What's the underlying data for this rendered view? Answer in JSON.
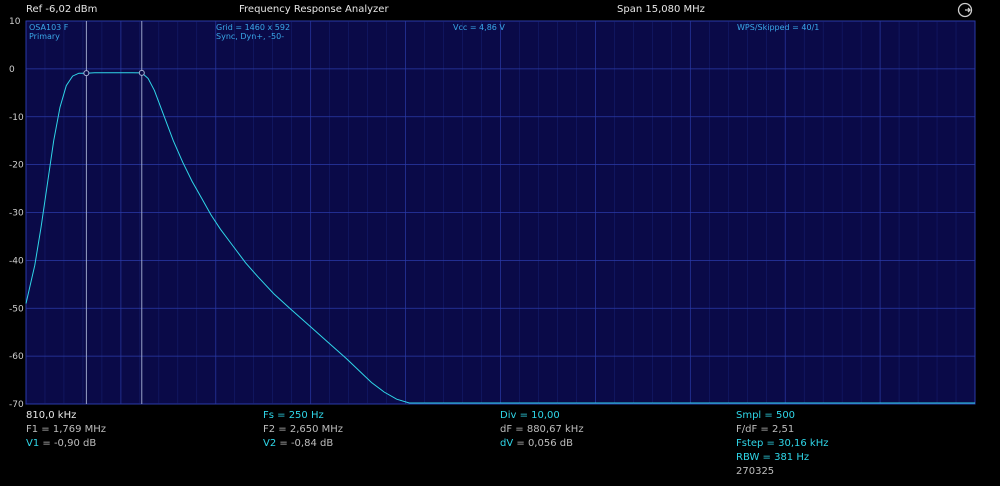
{
  "header": {
    "ref": "Ref  -6,02 dBm",
    "title": "Frequency Response Analyzer",
    "span": "Span 15,080 MHz"
  },
  "overlay": {
    "device": "OSA103 F",
    "mode": "Primary",
    "grid": "Grid = 1460 x 592",
    "sync": "Sync,  Dyn+,  -50-",
    "vcc": "Vcc = 4,86 V",
    "wps": "WPS/Skipped  = 40/1"
  },
  "footer": {
    "col1": {
      "start": "810,0 kHz",
      "f1": "F1 = 1,769 MHz",
      "v1_label": "V1",
      "v1_value": " = -0,90 dB"
    },
    "col2": {
      "fs": "Fs = 250 Hz",
      "f2": "F2 = 2,650 MHz",
      "v2_label": "V2",
      "v2_value": " = -0,84 dB"
    },
    "col3": {
      "div": "Div = 10,00",
      "df": "dF = 880,67 kHz",
      "dv_label": "dV",
      "dv_value": " = 0,056 dB"
    },
    "col4": {
      "smpl": "Smpl = 500",
      "fdf": "F/dF = 2,51",
      "fstep": "Fstep = 30,16 kHz",
      "rbw": "RBW = 381 Hz",
      "date": "270325"
    }
  },
  "colors": {
    "background": "#0a0a48",
    "grid": "#2a3aa8",
    "trace": "#2fd6e8",
    "marker": "#a9b3d6"
  },
  "icons": {
    "settings": "settings-icon"
  },
  "chart_data": {
    "type": "line",
    "xlabel": "",
    "ylabel": "",
    "x_unit": "MHz",
    "xlim": [
      0.81,
      15.89
    ],
    "ylim": [
      -70,
      10
    ],
    "yticks": [
      "10",
      "0",
      "-10",
      "-20",
      "-30",
      "-40",
      "-50",
      "-60",
      "-70"
    ],
    "grid": true,
    "markers": [
      {
        "label": "F1",
        "x": 1.769,
        "y": -0.9
      },
      {
        "label": "F2",
        "x": 2.65,
        "y": -0.84
      }
    ],
    "series": [
      {
        "x": [
          0.81,
          0.95,
          1.05,
          1.15,
          1.25,
          1.35,
          1.45,
          1.55,
          1.65,
          1.77,
          1.9,
          2.1,
          2.3,
          2.5,
          2.65,
          2.75,
          2.85,
          2.95,
          3.05,
          3.15,
          3.3,
          3.45,
          3.6,
          3.75,
          3.9,
          4.1,
          4.3,
          4.5,
          4.75,
          5.0,
          5.3,
          5.6,
          5.9,
          6.1,
          6.3,
          6.5,
          6.7,
          6.9,
          15.89
        ],
        "y": [
          -49,
          -41,
          -33,
          -24,
          -15,
          -8,
          -3.5,
          -1.5,
          -0.9,
          -0.9,
          -0.8,
          -0.8,
          -0.8,
          -0.8,
          -0.84,
          -2,
          -4.5,
          -8,
          -11.5,
          -15,
          -19.5,
          -23.5,
          -27,
          -30.5,
          -33.5,
          -37,
          -40.5,
          -43.5,
          -47,
          -50,
          -53.5,
          -57,
          -60.5,
          -63,
          -65.5,
          -67.5,
          -69,
          -69.8,
          -69.8
        ]
      }
    ]
  }
}
